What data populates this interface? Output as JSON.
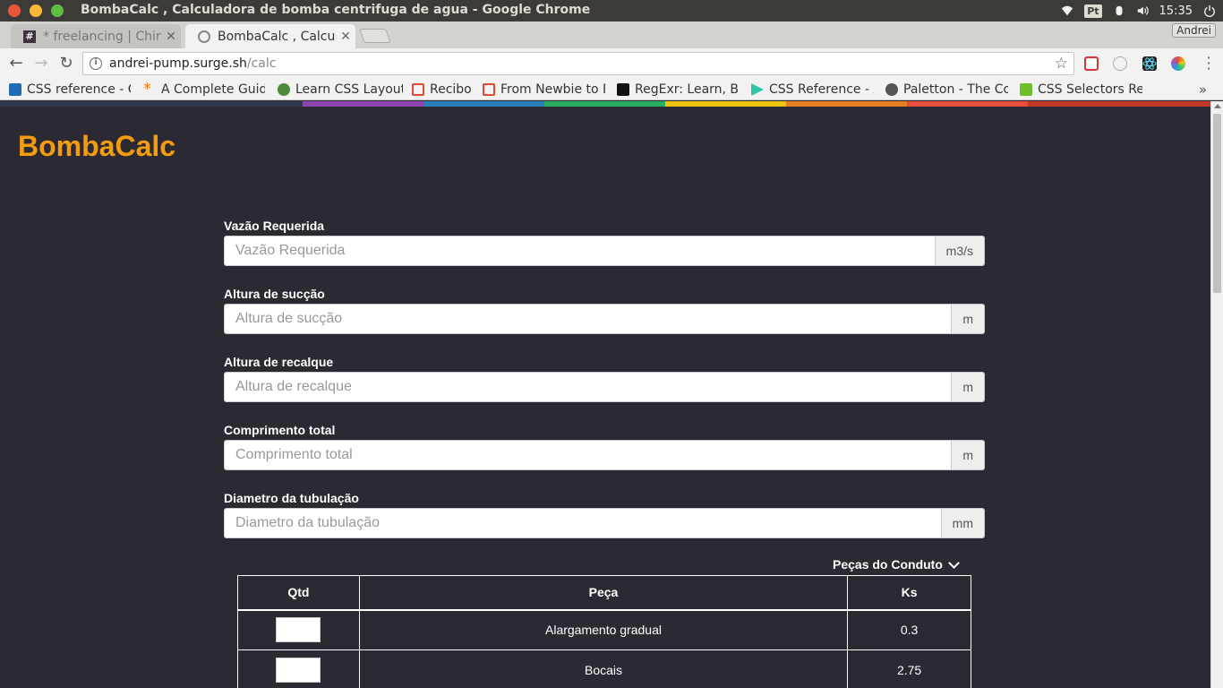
{
  "window": {
    "title": "BombaCalc , Calculadora de bomba centrifuga de agua - Google Chrome",
    "tray": {
      "keyboard": "Pt",
      "time": "15:35"
    }
  },
  "tabs": [
    {
      "label": "* freelancing | Chin",
      "active": false,
      "icon": "slack-icon"
    },
    {
      "label": "BombaCalc , Calcula",
      "active": true,
      "icon": "page-icon"
    }
  ],
  "profile_name": "Andrei",
  "address": {
    "host": "andrei-pump.surge.sh",
    "path": "/calc"
  },
  "bookmarks": [
    {
      "label": "CSS reference - C",
      "icon": "mdn-icon",
      "color": "#1f6ab4"
    },
    {
      "label": "A Complete Guid",
      "icon": "asterisk-icon",
      "color": "#ff7a00"
    },
    {
      "label": "Learn CSS Layout",
      "icon": "beetle-icon",
      "color": "#4f8a3a"
    },
    {
      "label": "Recibo",
      "icon": "doc-icon",
      "color": "#e04a2f"
    },
    {
      "label": "From Newbie to F",
      "icon": "doc-icon",
      "color": "#e04a2f"
    },
    {
      "label": "RegExr: Learn, B",
      "icon": "regexr-icon",
      "color": "#111111"
    },
    {
      "label": "CSS Reference - A",
      "icon": "codrops-icon",
      "color": "#2ec4a5"
    },
    {
      "label": "Paletton - The Co",
      "icon": "paletton-icon",
      "color": "#555555"
    },
    {
      "label": "CSS Selectors Ref",
      "icon": "w3-icon",
      "color": "#6fbf2a"
    }
  ],
  "app": {
    "brand": "BombaCalc",
    "brand_color": "#f39c12",
    "fields": [
      {
        "label": "Vazão Requerida",
        "placeholder": "Vazão Requerida",
        "unit": "m3/s"
      },
      {
        "label": "Altura de sucção",
        "placeholder": "Altura de sucção",
        "unit": "m"
      },
      {
        "label": "Altura de recalque",
        "placeholder": "Altura de recalque",
        "unit": "m"
      },
      {
        "label": "Comprimento total",
        "placeholder": "Comprimento total",
        "unit": "m"
      },
      {
        "label": "Diametro da tubulação",
        "placeholder": "Diametro da tubulação",
        "unit": "mm"
      }
    ],
    "pecas_toggle": "Peças do Conduto",
    "table": {
      "headers": [
        "Qtd",
        "Peça",
        "Ks"
      ],
      "rows": [
        {
          "peca": "Alargamento gradual",
          "ks": "0.3"
        },
        {
          "peca": "Bocais",
          "ks": "2.75"
        }
      ]
    }
  },
  "colorbar": [
    "#2f3b4a",
    "#8e44ad",
    "#2980b9",
    "#27ae60",
    "#f1c40f",
    "#e67e22",
    "#e74c3c",
    "#c0392b"
  ]
}
